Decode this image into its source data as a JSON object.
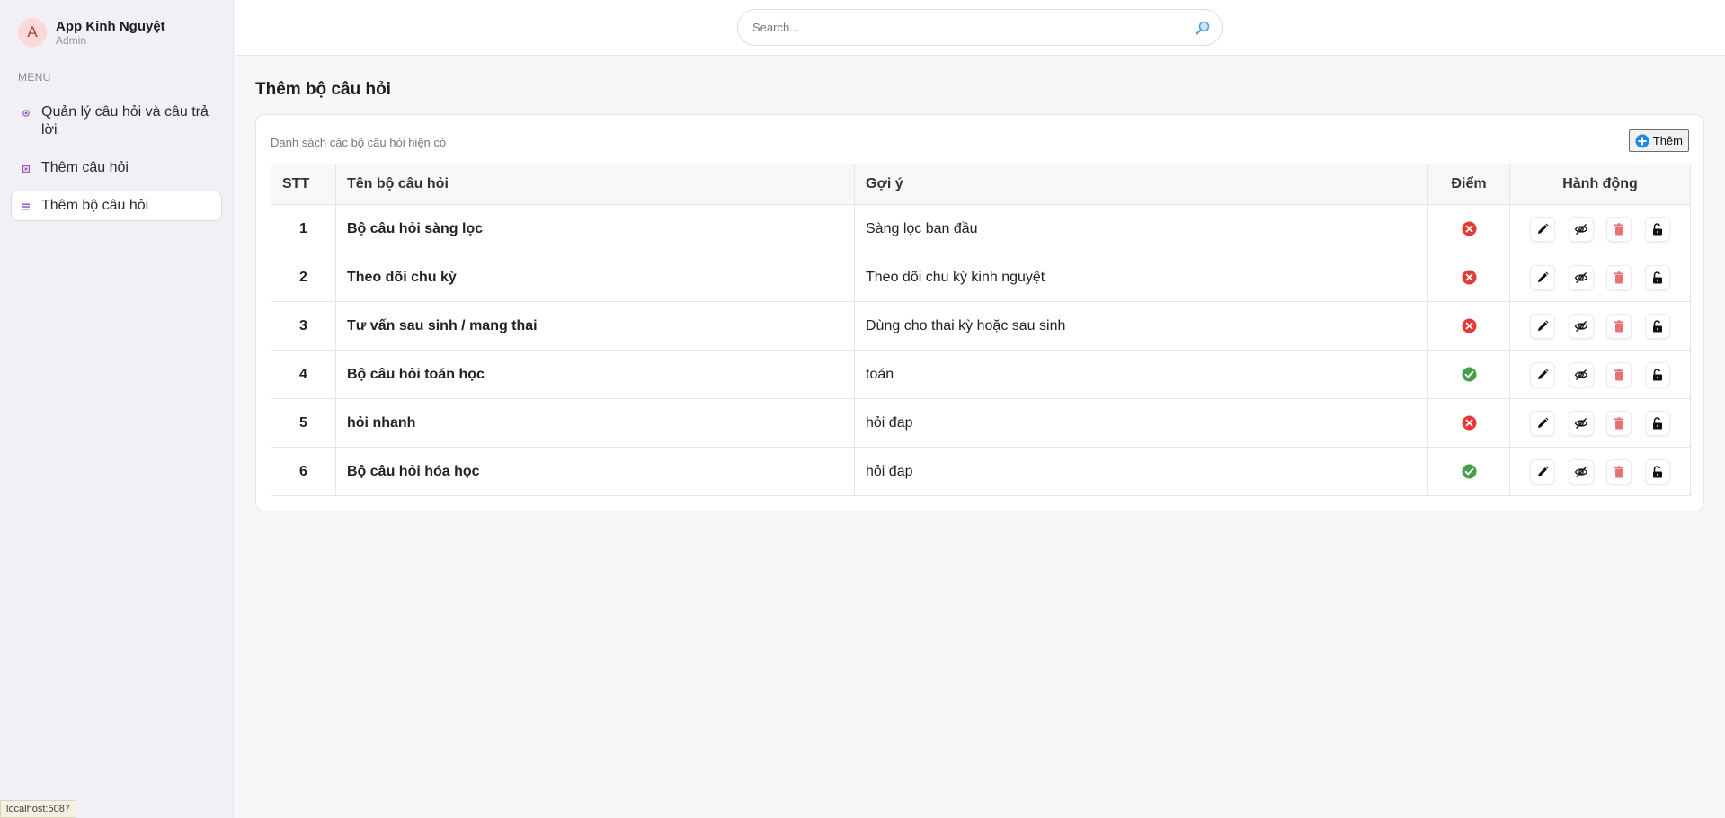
{
  "app": {
    "name": "App Kinh Nguyệt",
    "role": "Admin",
    "avatar_letter": "A"
  },
  "sidebar": {
    "menu_title": "MENU",
    "items": [
      {
        "label": "Quản lý câu hỏi và câu trả lời",
        "icon": "circle-dot-icon",
        "color": "#8e5cc4",
        "active": false
      },
      {
        "label": "Thêm câu hỏi",
        "icon": "square-dot-icon",
        "color": "#a855c5",
        "active": false
      },
      {
        "label": "Thêm bộ câu hỏi",
        "icon": "list-icon",
        "color": "#8e5cc4",
        "active": true
      }
    ]
  },
  "search": {
    "placeholder": "Search..."
  },
  "page": {
    "title": "Thêm bộ câu hỏi",
    "card_subtitle": "Danh sách các bộ câu hỏi hiện có",
    "add_label": "Thêm"
  },
  "table": {
    "headers": {
      "stt": "STT",
      "name": "Tên bộ câu hỏi",
      "hint": "Gợi ý",
      "score": "Điểm",
      "actions": "Hành động"
    },
    "rows": [
      {
        "stt": "1",
        "name": "Bộ câu hỏi sàng lọc",
        "hint": "Sàng lọc ban đầu",
        "score": false
      },
      {
        "stt": "2",
        "name": "Theo dõi chu kỳ",
        "hint": "Theo dõi chu kỳ kinh nguyệt",
        "score": false
      },
      {
        "stt": "3",
        "name": "Tư vấn sau sinh / mang thai",
        "hint": "Dùng cho thai kỳ hoặc sau sinh",
        "score": false
      },
      {
        "stt": "4",
        "name": "Bộ câu hỏi toán học",
        "hint": "toán",
        "score": true
      },
      {
        "stt": "5",
        "name": "hỏi nhanh",
        "hint": "hỏi đap",
        "score": false
      },
      {
        "stt": "6",
        "name": "Bộ câu hỏi hóa học",
        "hint": "hỏi đap",
        "score": true
      }
    ],
    "row_actions": [
      "edit-icon",
      "hide-icon",
      "delete-icon",
      "unlock-icon"
    ]
  },
  "colors": {
    "accent": "#8e5cc4",
    "error": "#e53935",
    "success": "#43a047",
    "delete": "#e57373",
    "add_icon": "#1e88e5"
  },
  "statusbar": {
    "url": "localhost:5087"
  }
}
